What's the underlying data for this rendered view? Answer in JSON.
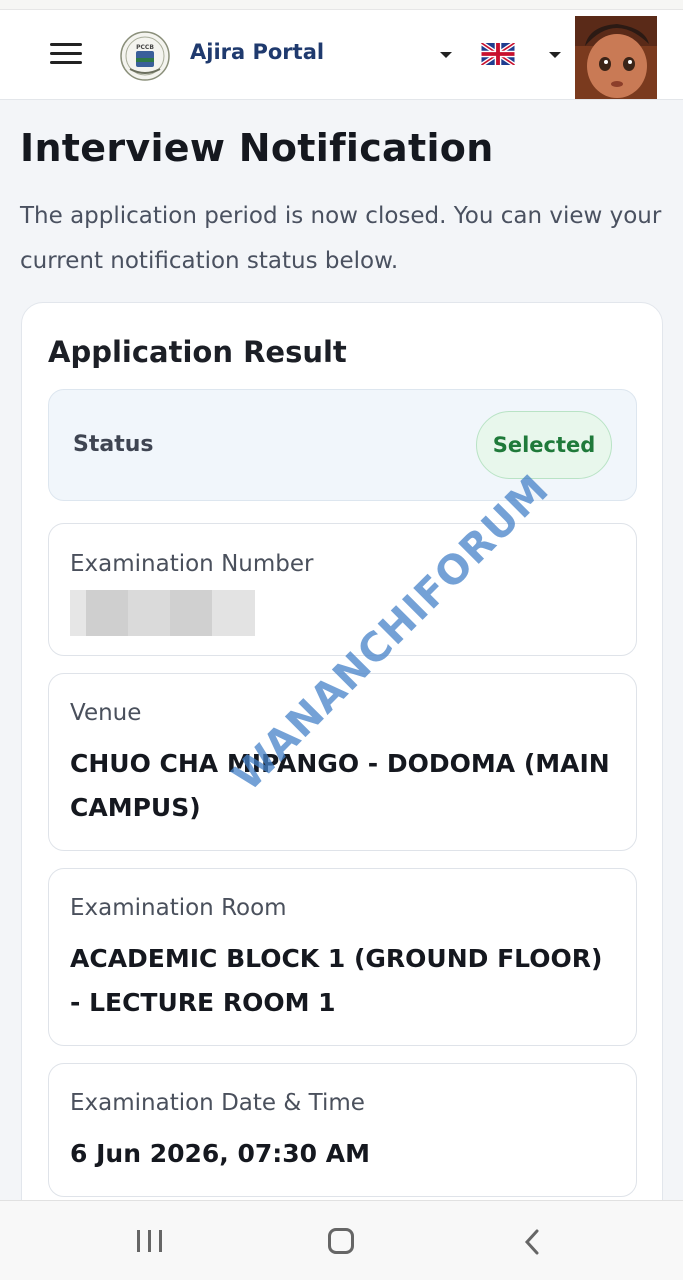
{
  "header": {
    "brand": "Ajira Portal",
    "logo_text": "PCCB",
    "language": "English"
  },
  "page": {
    "title": "Interview Notification",
    "subtitle": "The application period is now closed. You can view your current notification status below."
  },
  "result": {
    "card_title": "Application Result",
    "status_label": "Status",
    "status_value": "Selected",
    "fields": [
      {
        "label": "Examination Number",
        "value": ""
      },
      {
        "label": "Venue",
        "value": "CHUO CHA MIPANGO - DODOMA (MAIN CAMPUS)"
      },
      {
        "label": "Examination Room",
        "value": "ACADEMIC BLOCK 1 (GROUND FLOOR) - LECTURE ROOM 1"
      },
      {
        "label": "Examination Date & Time",
        "value": "6 Jun 2026, 07:30 AM"
      }
    ]
  },
  "watermark": "WANANCHIFORUM",
  "colors": {
    "brand": "#1f3a6e",
    "selected_text": "#1f7a3a",
    "selected_bg": "#e8f7ec",
    "watermark": "#4682c8"
  }
}
